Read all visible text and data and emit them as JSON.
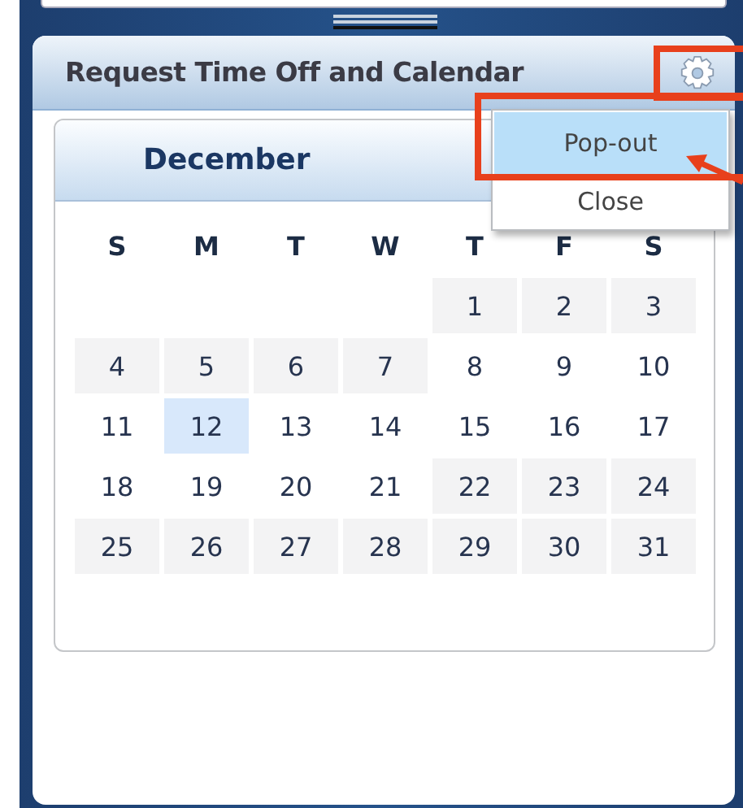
{
  "panel": {
    "title": "Request Time Off and Calendar"
  },
  "menu": {
    "items": [
      {
        "label": "Pop-out",
        "selected": true
      },
      {
        "label": "Close",
        "selected": false
      }
    ]
  },
  "calendar": {
    "month": "December",
    "weekdays": [
      "S",
      "M",
      "T",
      "W",
      "T",
      "F",
      "S"
    ],
    "weeks": [
      [
        {
          "kind": "blank"
        },
        {
          "kind": "blank"
        },
        {
          "kind": "blank"
        },
        {
          "kind": "blank"
        },
        {
          "kind": "day",
          "label": "1",
          "shaded": true,
          "selected": false
        },
        {
          "kind": "day",
          "label": "2",
          "shaded": true,
          "selected": false
        },
        {
          "kind": "day",
          "label": "3",
          "shaded": true,
          "selected": false
        }
      ],
      [
        {
          "kind": "day",
          "label": "4",
          "shaded": true,
          "selected": false
        },
        {
          "kind": "day",
          "label": "5",
          "shaded": true,
          "selected": false
        },
        {
          "kind": "day",
          "label": "6",
          "shaded": true,
          "selected": false
        },
        {
          "kind": "day",
          "label": "7",
          "shaded": true,
          "selected": false
        },
        {
          "kind": "day",
          "label": "8",
          "shaded": false,
          "selected": false
        },
        {
          "kind": "day",
          "label": "9",
          "shaded": false,
          "selected": false
        },
        {
          "kind": "day",
          "label": "10",
          "shaded": false,
          "selected": false
        }
      ],
      [
        {
          "kind": "day",
          "label": "11",
          "shaded": false,
          "selected": false
        },
        {
          "kind": "day",
          "label": "12",
          "shaded": false,
          "selected": true
        },
        {
          "kind": "day",
          "label": "13",
          "shaded": false,
          "selected": false
        },
        {
          "kind": "day",
          "label": "14",
          "shaded": false,
          "selected": false
        },
        {
          "kind": "day",
          "label": "15",
          "shaded": false,
          "selected": false
        },
        {
          "kind": "day",
          "label": "16",
          "shaded": false,
          "selected": false
        },
        {
          "kind": "day",
          "label": "17",
          "shaded": false,
          "selected": false
        }
      ],
      [
        {
          "kind": "day",
          "label": "18",
          "shaded": false,
          "selected": false
        },
        {
          "kind": "day",
          "label": "19",
          "shaded": false,
          "selected": false
        },
        {
          "kind": "day",
          "label": "20",
          "shaded": false,
          "selected": false
        },
        {
          "kind": "day",
          "label": "21",
          "shaded": false,
          "selected": false
        },
        {
          "kind": "day",
          "label": "22",
          "shaded": true,
          "selected": false
        },
        {
          "kind": "day",
          "label": "23",
          "shaded": true,
          "selected": false
        },
        {
          "kind": "day",
          "label": "24",
          "shaded": true,
          "selected": false
        }
      ],
      [
        {
          "kind": "day",
          "label": "25",
          "shaded": true,
          "selected": false
        },
        {
          "kind": "day",
          "label": "26",
          "shaded": true,
          "selected": false
        },
        {
          "kind": "day",
          "label": "27",
          "shaded": true,
          "selected": false
        },
        {
          "kind": "day",
          "label": "28",
          "shaded": true,
          "selected": false
        },
        {
          "kind": "day",
          "label": "29",
          "shaded": true,
          "selected": false
        },
        {
          "kind": "day",
          "label": "30",
          "shaded": true,
          "selected": false
        },
        {
          "kind": "day",
          "label": "31",
          "shaded": true,
          "selected": false
        }
      ]
    ]
  },
  "annotations": [
    {
      "kind": "gear_frame"
    },
    {
      "kind": "menu_frame"
    },
    {
      "kind": "arrow"
    }
  ]
}
